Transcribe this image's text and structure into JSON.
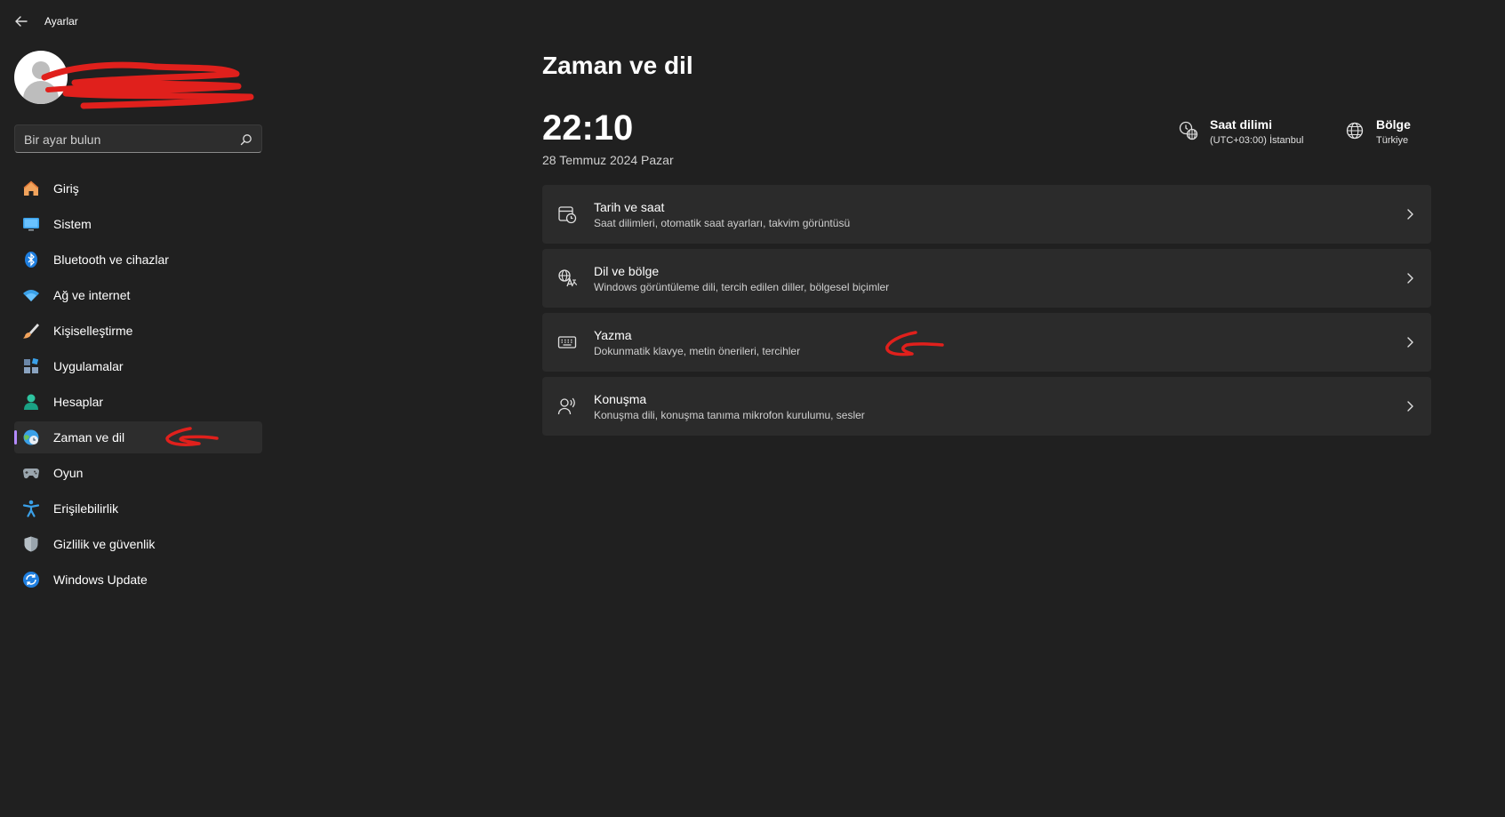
{
  "window": {
    "title": "Ayarlar"
  },
  "profile": {
    "name": "",
    "email": ""
  },
  "search": {
    "placeholder": "Bir ayar bulun",
    "value": ""
  },
  "sidebar": {
    "items": [
      {
        "label": "Giriş",
        "icon": "home-icon"
      },
      {
        "label": "Sistem",
        "icon": "monitor-icon"
      },
      {
        "label": "Bluetooth ve cihazlar",
        "icon": "bluetooth-icon"
      },
      {
        "label": "Ağ ve internet",
        "icon": "wifi-icon"
      },
      {
        "label": "Kişiselleştirme",
        "icon": "brush-icon"
      },
      {
        "label": "Uygulamalar",
        "icon": "apps-icon"
      },
      {
        "label": "Hesaplar",
        "icon": "person-icon"
      },
      {
        "label": "Zaman ve dil",
        "icon": "globe-clock-icon",
        "active": true
      },
      {
        "label": "Oyun",
        "icon": "gamepad-icon"
      },
      {
        "label": "Erişilebilirlik",
        "icon": "accessibility-icon"
      },
      {
        "label": "Gizlilik ve güvenlik",
        "icon": "shield-icon"
      },
      {
        "label": "Windows Update",
        "icon": "update-icon"
      }
    ]
  },
  "main": {
    "title": "Zaman ve dil",
    "time": "22:10",
    "date": "28 Temmuz 2024 Pazar",
    "timezone": {
      "title": "Saat dilimi",
      "value": "(UTC+03:00) İstanbul"
    },
    "region": {
      "title": "Bölge",
      "value": "Türkiye"
    },
    "cards": [
      {
        "title": "Tarih ve saat",
        "desc": "Saat dilimleri, otomatik saat ayarları, takvim görüntüsü",
        "icon": "calendar-clock-icon"
      },
      {
        "title": "Dil ve bölge",
        "desc": "Windows görüntüleme dili, tercih edilen diller, bölgesel biçimler",
        "icon": "language-icon"
      },
      {
        "title": "Yazma",
        "desc": "Dokunmatik klavye, metin önerileri, tercihler",
        "icon": "keyboard-icon"
      },
      {
        "title": "Konuşma",
        "desc": "Konuşma dili, konuşma tanıma mikrofon kurulumu, sesler",
        "icon": "speech-icon"
      }
    ]
  },
  "colors": {
    "background": "#202020",
    "card": "#2b2b2b",
    "accent": "#b48aff",
    "annotation": "#e0201c"
  }
}
